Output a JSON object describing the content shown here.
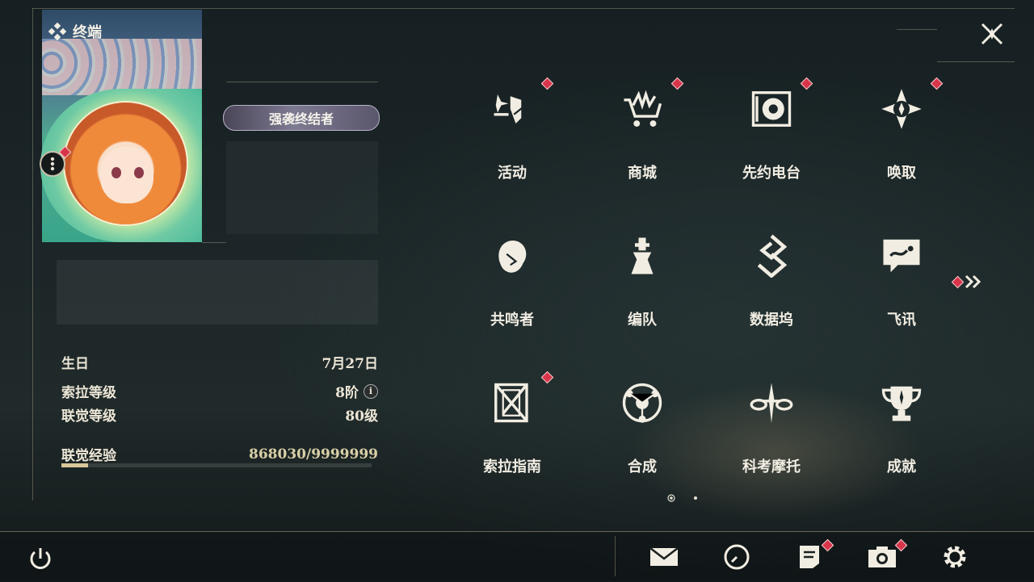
{
  "window": {
    "title": "终端"
  },
  "profile": {
    "title_badge": "强袭终结者",
    "birthday_label": "生日",
    "birthday_value": "7月27日",
    "sola_level_label": "索拉等级",
    "sola_level_value": "8阶",
    "info_icon": "i",
    "union_level_label": "联觉等级",
    "union_level_value": "80级",
    "union_exp_label": "联觉经验",
    "union_exp_value": "868030/9999999",
    "union_exp_progress": 0.087
  },
  "menu": {
    "items": [
      {
        "label": "活动",
        "icon": "activity-icon",
        "notify": true
      },
      {
        "label": "商城",
        "icon": "shop-cart-icon",
        "notify": true
      },
      {
        "label": "先约电台",
        "icon": "radio-icon",
        "notify": true
      },
      {
        "label": "唤取",
        "icon": "convene-icon",
        "notify": true
      },
      {
        "label": "共鸣者",
        "icon": "resonator-icon",
        "notify": false
      },
      {
        "label": "编队",
        "icon": "team-icon",
        "notify": false
      },
      {
        "label": "数据坞",
        "icon": "data-bank-icon",
        "notify": false
      },
      {
        "label": "飞讯",
        "icon": "chat-icon",
        "notify": false
      },
      {
        "label": "索拉指南",
        "icon": "guidebook-icon",
        "notify": true
      },
      {
        "label": "合成",
        "icon": "synthesis-icon",
        "notify": false
      },
      {
        "label": "科考摩托",
        "icon": "motorcycle-icon",
        "notify": false
      },
      {
        "label": "成就",
        "icon": "trophy-icon",
        "notify": false
      }
    ],
    "next_page_icon": "double-chevron-right-icon",
    "pages": 2,
    "current_page": 1
  },
  "bottom_bar": {
    "icons": [
      "power-icon",
      "mail-icon",
      "clock-icon",
      "notes-icon",
      "camera-icon",
      "settings-gear-icon"
    ]
  },
  "colors": {
    "accent": "#d9c89a",
    "notify_red": "#d8344a",
    "text": "#f1ede2"
  }
}
